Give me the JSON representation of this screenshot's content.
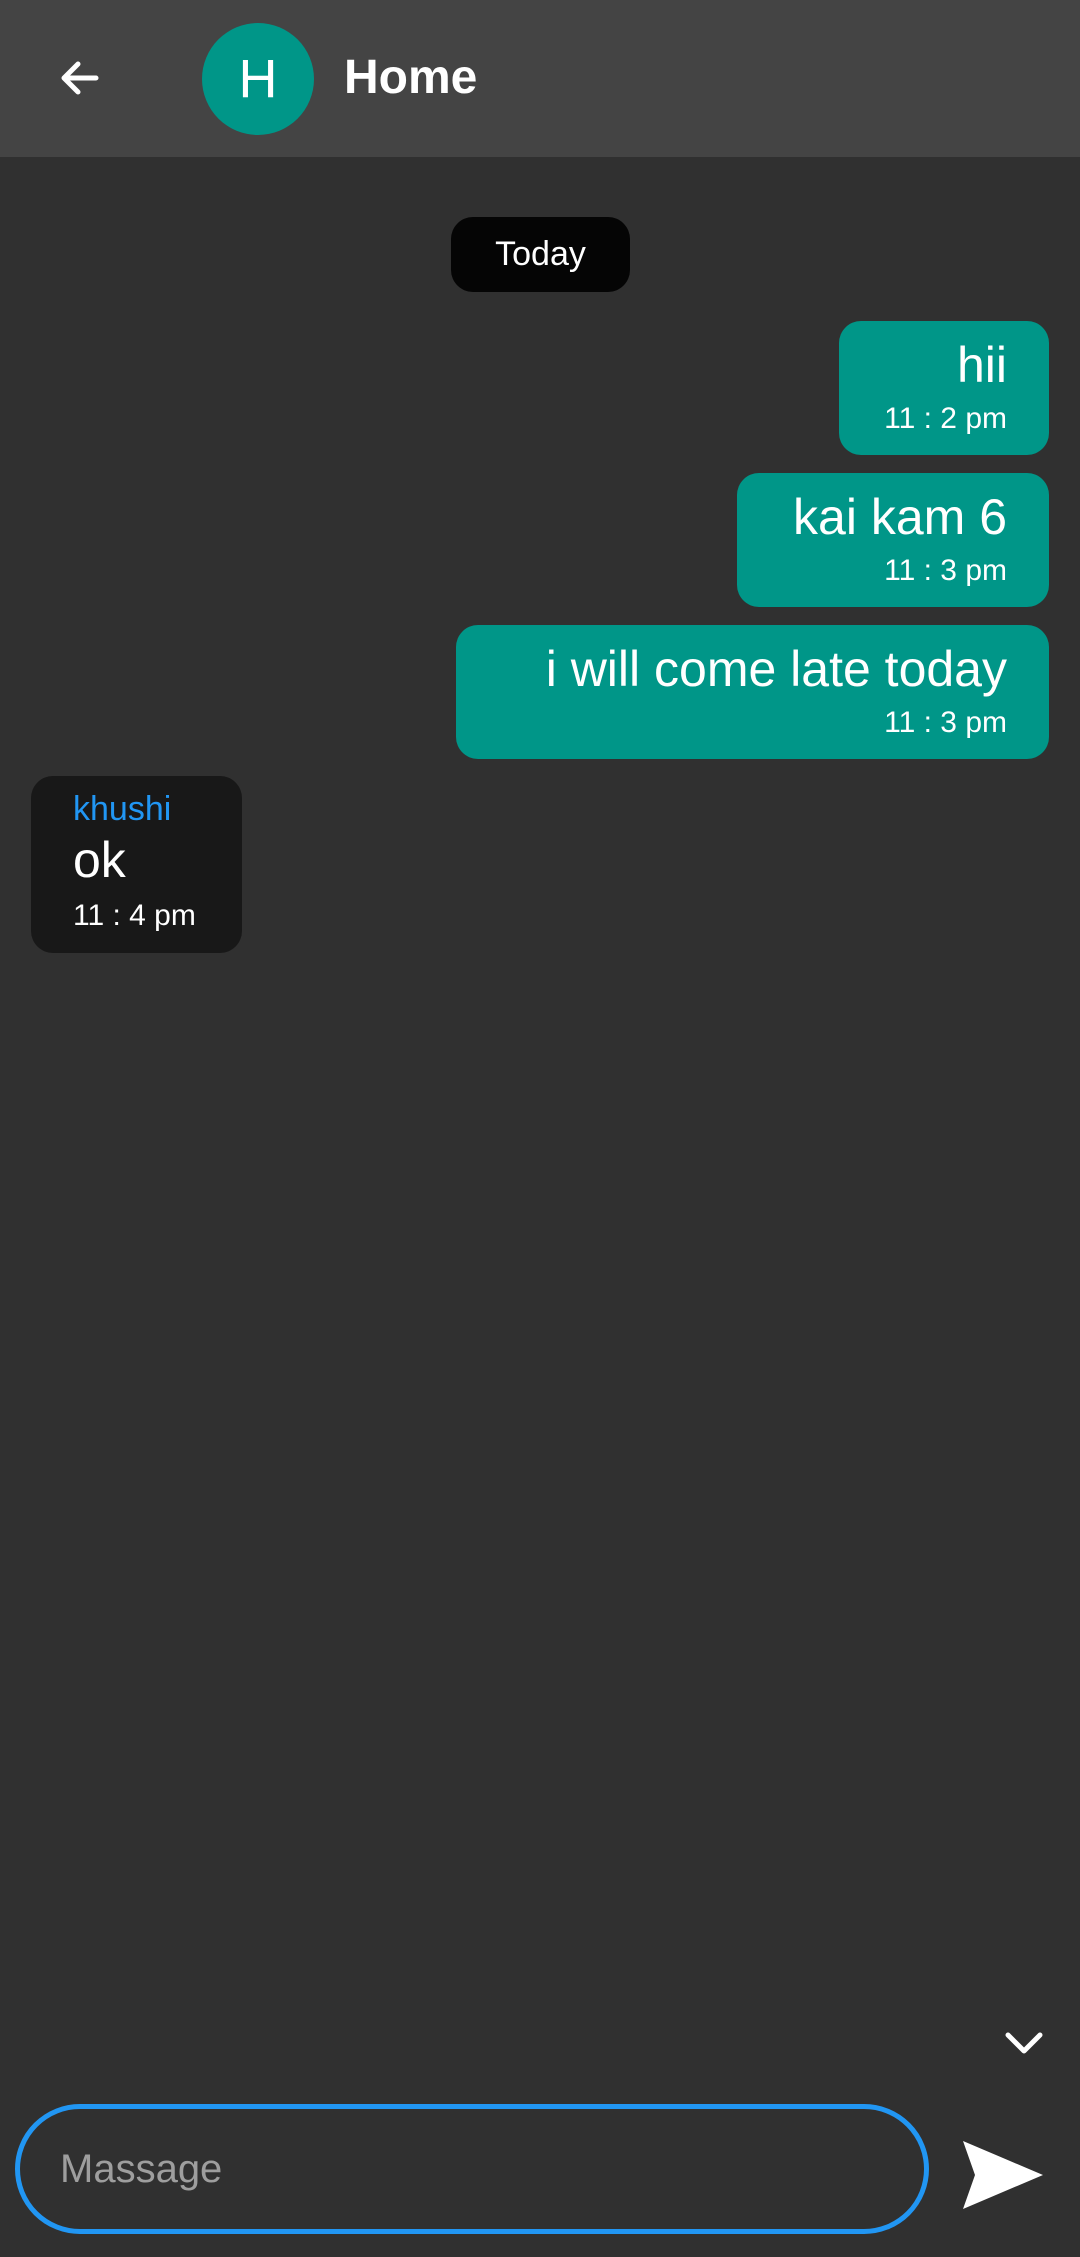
{
  "header": {
    "title": "Home",
    "avatar_letter": "H",
    "avatar_color": "#009688",
    "back_icon": "arrow-left-icon"
  },
  "date_separator": "Today",
  "messages": [
    {
      "direction": "outgoing",
      "text": "hii",
      "time": "11 : 2 pm"
    },
    {
      "direction": "outgoing",
      "text": "kai kam 6",
      "time": "11 : 3 pm"
    },
    {
      "direction": "outgoing",
      "text": "i will come late today",
      "time": "11 : 3 pm"
    },
    {
      "direction": "incoming",
      "sender": "khushi",
      "text": "ok",
      "time": "11 : 4 pm"
    }
  ],
  "composer": {
    "placeholder": "Massage",
    "value": "",
    "send_icon": "send-icon",
    "scroll_icon": "chevron-down-icon"
  },
  "colors": {
    "background": "#303030",
    "appbar": "#444444",
    "outgoing_bubble": "#009688",
    "incoming_bubble": "#181818",
    "accent": "#2196f3"
  }
}
